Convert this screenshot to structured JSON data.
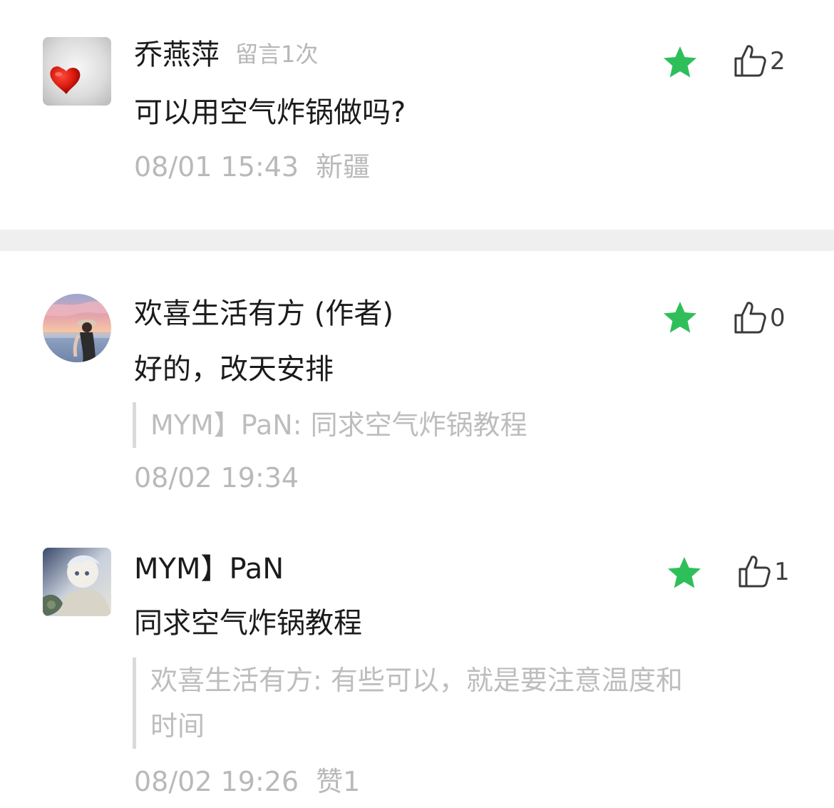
{
  "comments": [
    {
      "name": "乔燕萍",
      "meta": "留言1次",
      "content": "可以用空气炸锅做吗?",
      "time": "08/01 15:43",
      "location": "新疆",
      "likes": "2",
      "starred": true
    },
    {
      "name": "欢喜生活有方 (作者)",
      "content": "好的，改天安排",
      "quote": "MYM】PaN: 同求空气炸锅教程",
      "time": "08/02 19:34",
      "likes": "0",
      "starred": true
    },
    {
      "name": "MYM】PaN",
      "content": "同求空气炸锅教程",
      "quote_line1": "欢喜生活有方: 有些可以，就是要注意温度和",
      "quote_line2": "时间",
      "time": "08/02 19:26",
      "extra": "赞1",
      "likes": "1",
      "starred": true
    }
  ],
  "colors": {
    "star": "#2fbf5a",
    "text": "#1b1b1b",
    "muted": "#b9b9b9",
    "divider": "#efefef"
  },
  "icons": {
    "star": "star-icon",
    "like": "thumbs-up-icon"
  }
}
